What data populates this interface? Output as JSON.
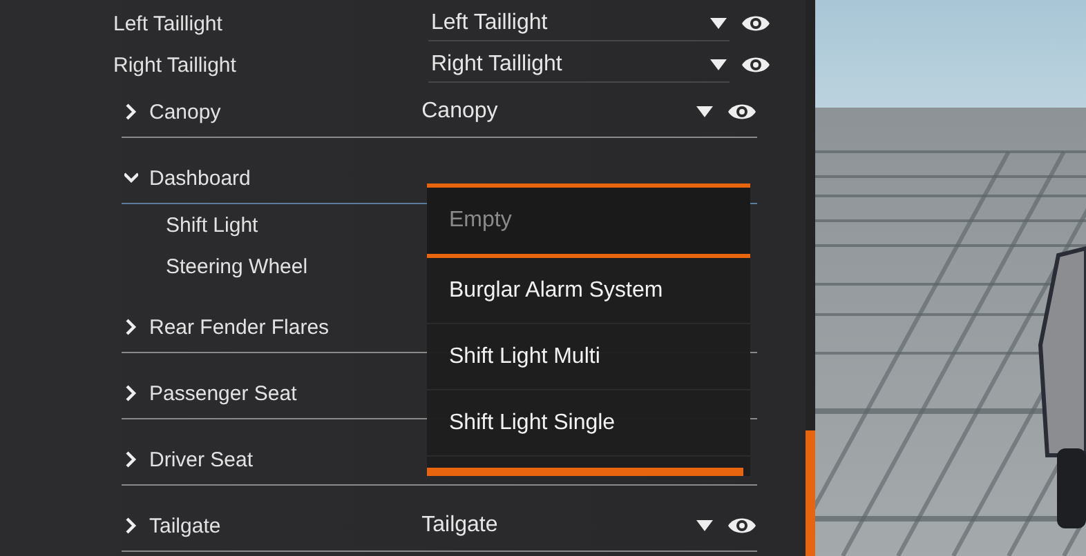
{
  "parts": [
    {
      "kind": "slot",
      "label": "Left Taillight",
      "value": "Left Taillight"
    },
    {
      "kind": "slot",
      "label": "Right Taillight",
      "value": "Right Taillight"
    },
    {
      "kind": "group",
      "label": "Canopy",
      "value": "Canopy",
      "expanded": false
    },
    {
      "kind": "group",
      "label": "Dashboard",
      "expanded": true,
      "children": [
        {
          "label": "Shift Light"
        },
        {
          "label": "Steering Wheel"
        }
      ]
    },
    {
      "kind": "group",
      "label": "Rear Fender Flares",
      "expanded": false
    },
    {
      "kind": "group",
      "label": "Passenger Seat",
      "expanded": false
    },
    {
      "kind": "group",
      "label": "Driver Seat",
      "expanded": false
    },
    {
      "kind": "group",
      "label": "Tailgate",
      "value": "Tailgate",
      "expanded": false
    }
  ],
  "dropdown": {
    "options": [
      {
        "label": "Empty",
        "selected": true
      },
      {
        "label": "Burglar Alarm System",
        "selected": false
      },
      {
        "label": "Shift Light Multi",
        "selected": false
      },
      {
        "label": "Shift Light Single",
        "selected": false
      }
    ]
  }
}
